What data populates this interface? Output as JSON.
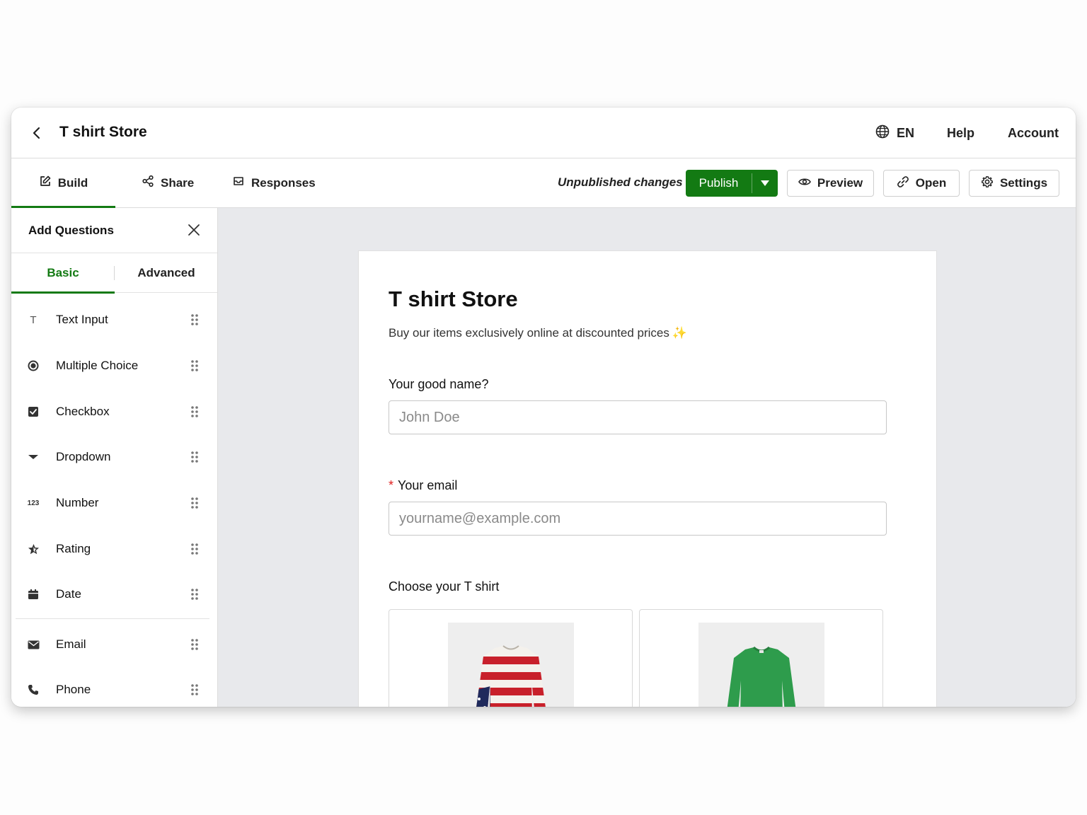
{
  "header": {
    "title": "T shirt Store",
    "language": "EN",
    "help": "Help",
    "account": "Account"
  },
  "toolbar": {
    "tabs": [
      {
        "label": "Build"
      },
      {
        "label": "Share"
      },
      {
        "label": "Responses"
      }
    ],
    "status": "Unpublished changes",
    "publish": "Publish",
    "preview": "Preview",
    "open": "Open",
    "settings": "Settings",
    "accent_color": "#137a13"
  },
  "sidebar": {
    "title": "Add Questions",
    "tabs": {
      "basic": "Basic",
      "advanced": "Advanced"
    },
    "items": [
      {
        "label": "Text Input",
        "icon": "text-icon",
        "glyph": "T"
      },
      {
        "label": "Multiple Choice",
        "icon": "radio-icon"
      },
      {
        "label": "Checkbox",
        "icon": "checkbox-icon"
      },
      {
        "label": "Dropdown",
        "icon": "caret-down-icon"
      },
      {
        "label": "Number",
        "icon": "number-icon",
        "glyph": "123"
      },
      {
        "label": "Rating",
        "icon": "star-icon"
      },
      {
        "label": "Date",
        "icon": "calendar-icon"
      },
      {
        "label": "Email",
        "icon": "envelope-icon"
      },
      {
        "label": "Phone",
        "icon": "phone-icon"
      }
    ]
  },
  "form": {
    "title": "T shirt Store",
    "description": "Buy our items exclusively online at discounted prices",
    "questions": [
      {
        "label": "Your good name?",
        "placeholder": "John Doe"
      },
      {
        "label": "Your email",
        "required_mark": "*",
        "placeholder": "yourname@example.com"
      },
      {
        "label": "Choose your T shirt"
      }
    ],
    "options": [
      {
        "name": "striped-flag-sweater",
        "color": "#c8202a"
      },
      {
        "name": "green-sweater",
        "color": "#2e9c4c"
      }
    ]
  }
}
